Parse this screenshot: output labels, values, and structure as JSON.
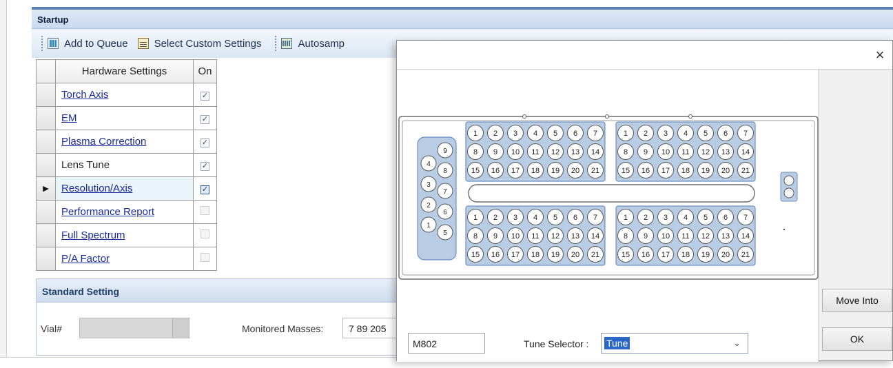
{
  "window": {
    "title": "Startup"
  },
  "toolbar": {
    "add_to_queue": "Add to Queue",
    "select_custom": "Select Custom Settings",
    "autosampler": "Autosamp"
  },
  "hardware_table": {
    "headers": {
      "name": "Hardware Settings",
      "on": "On"
    },
    "rows": [
      {
        "label": "Torch Axis",
        "link": true,
        "checked": true,
        "selected": false
      },
      {
        "label": "EM",
        "link": true,
        "checked": true,
        "selected": false
      },
      {
        "label": "Plasma Correction",
        "link": true,
        "checked": true,
        "selected": false
      },
      {
        "label": "Lens Tune",
        "link": false,
        "checked": true,
        "selected": false
      },
      {
        "label": "Resolution/Axis",
        "link": true,
        "checked": true,
        "selected": true
      },
      {
        "label": "Performance Report",
        "link": true,
        "checked": false,
        "selected": false
      },
      {
        "label": "Full Spectrum",
        "link": true,
        "checked": false,
        "selected": false
      },
      {
        "label": "P/A Factor",
        "link": true,
        "checked": false,
        "selected": false
      }
    ]
  },
  "standard": {
    "title": "Standard Setting",
    "vial_label": "Vial#",
    "monitored_label": "Monitored Masses:",
    "monitored_value": "7 89 205"
  },
  "dialog": {
    "close": "×",
    "move_into": "Move Into",
    "ok": "OK",
    "code_value": "M802",
    "tune_selector_label": "Tune Selector :",
    "tune_selector_value": "Tune",
    "rack": {
      "grid_numbers": [
        "1",
        "2",
        "3",
        "4",
        "5",
        "6",
        "7",
        "8",
        "9",
        "10",
        "11",
        "12",
        "13",
        "14",
        "15",
        "16",
        "17",
        "18",
        "19",
        "20",
        "21"
      ],
      "left_vials": [
        "9",
        "4",
        "8",
        "3",
        "7",
        "2",
        "6",
        "1",
        "5"
      ]
    }
  },
  "colors": {
    "accent": "#5a7fb5",
    "rack_fill": "#b8cce4",
    "rack_stroke": "#6e8fbe",
    "link": "#1a2b9b"
  },
  "icons": [
    "add-queue-icon",
    "custom-settings-icon",
    "autosampler-icon",
    "close-icon",
    "chevron-down-icon",
    "row-pointer-icon"
  ]
}
